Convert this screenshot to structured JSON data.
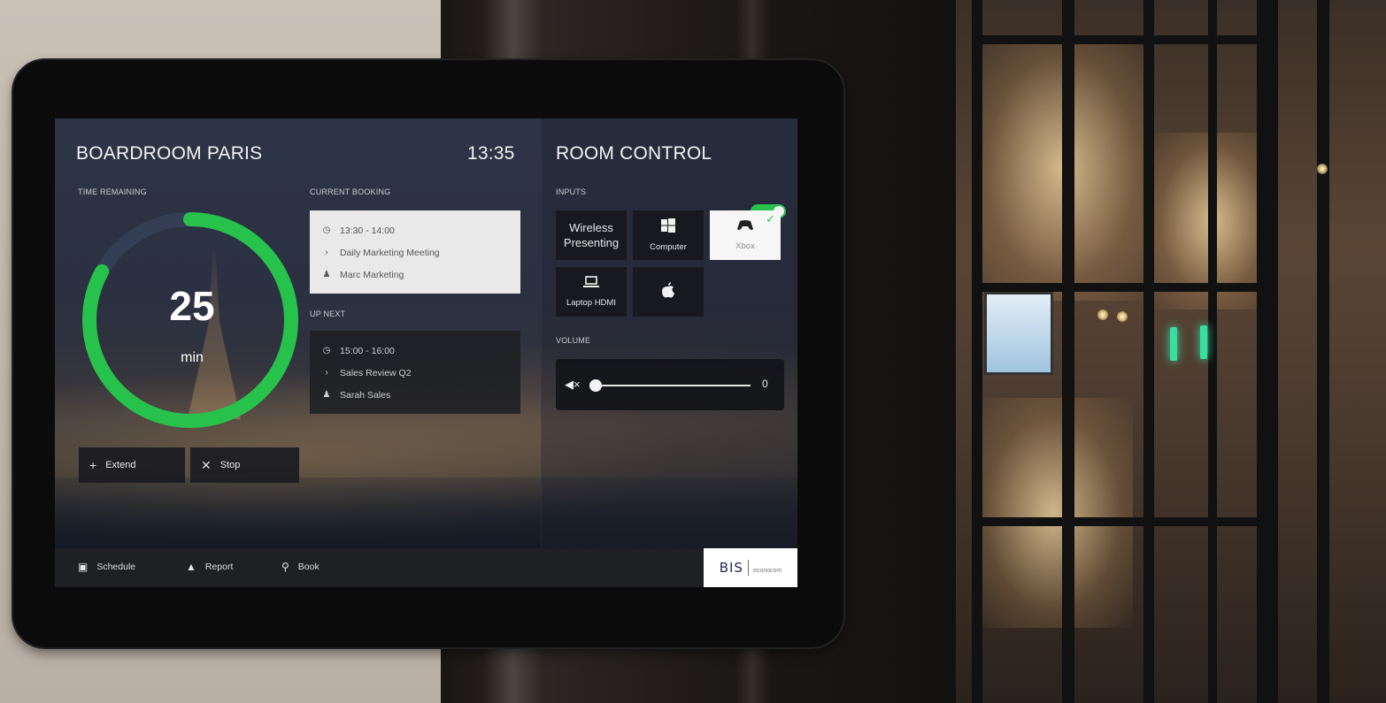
{
  "room": {
    "name": "BOARDROOM PARIS",
    "time": "13:35"
  },
  "timer": {
    "label": "TIME REMAINING",
    "value": "25",
    "unit": "min",
    "fraction_remaining": 0.83
  },
  "actions": {
    "extend": {
      "icon": "plus-icon",
      "label": "Extend"
    },
    "stop": {
      "icon": "close-icon",
      "label": "Stop"
    }
  },
  "current_booking": {
    "label": "CURRENT BOOKING",
    "time": "13:30 - 14:00",
    "title": "Daily Marketing Meeting",
    "organizer": "Marc Marketing"
  },
  "up_next": {
    "label": "UP NEXT",
    "time": "15:00 - 16:00",
    "title": "Sales Review Q2",
    "organizer": "Sarah Sales"
  },
  "room_control": {
    "title": "ROOM CONTROL",
    "enabled": true,
    "accent_color": "#27c24c",
    "inputs_label": "INPUTS",
    "inputs": [
      {
        "label": "Wireless Presenting",
        "icon": "",
        "selected": false
      },
      {
        "label": "Computer",
        "icon": "windows-icon",
        "selected": false
      },
      {
        "label": "Xbox",
        "icon": "gamepad-icon",
        "selected": true
      },
      {
        "label": "Laptop HDMI",
        "icon": "laptop-icon",
        "selected": false
      },
      {
        "label": "",
        "icon": "apple-icon",
        "selected": false
      }
    ],
    "volume_label": "VOLUME",
    "volume": {
      "value": "0",
      "icon": "mute-icon"
    }
  },
  "footer": {
    "schedule": {
      "icon": "calendar-icon",
      "label": "Schedule"
    },
    "report": {
      "icon": "warning-icon",
      "label": "Report"
    },
    "book": {
      "icon": "search-icon",
      "label": "Book"
    },
    "logo": {
      "primary": "BIS",
      "secondary": "econocom"
    }
  }
}
